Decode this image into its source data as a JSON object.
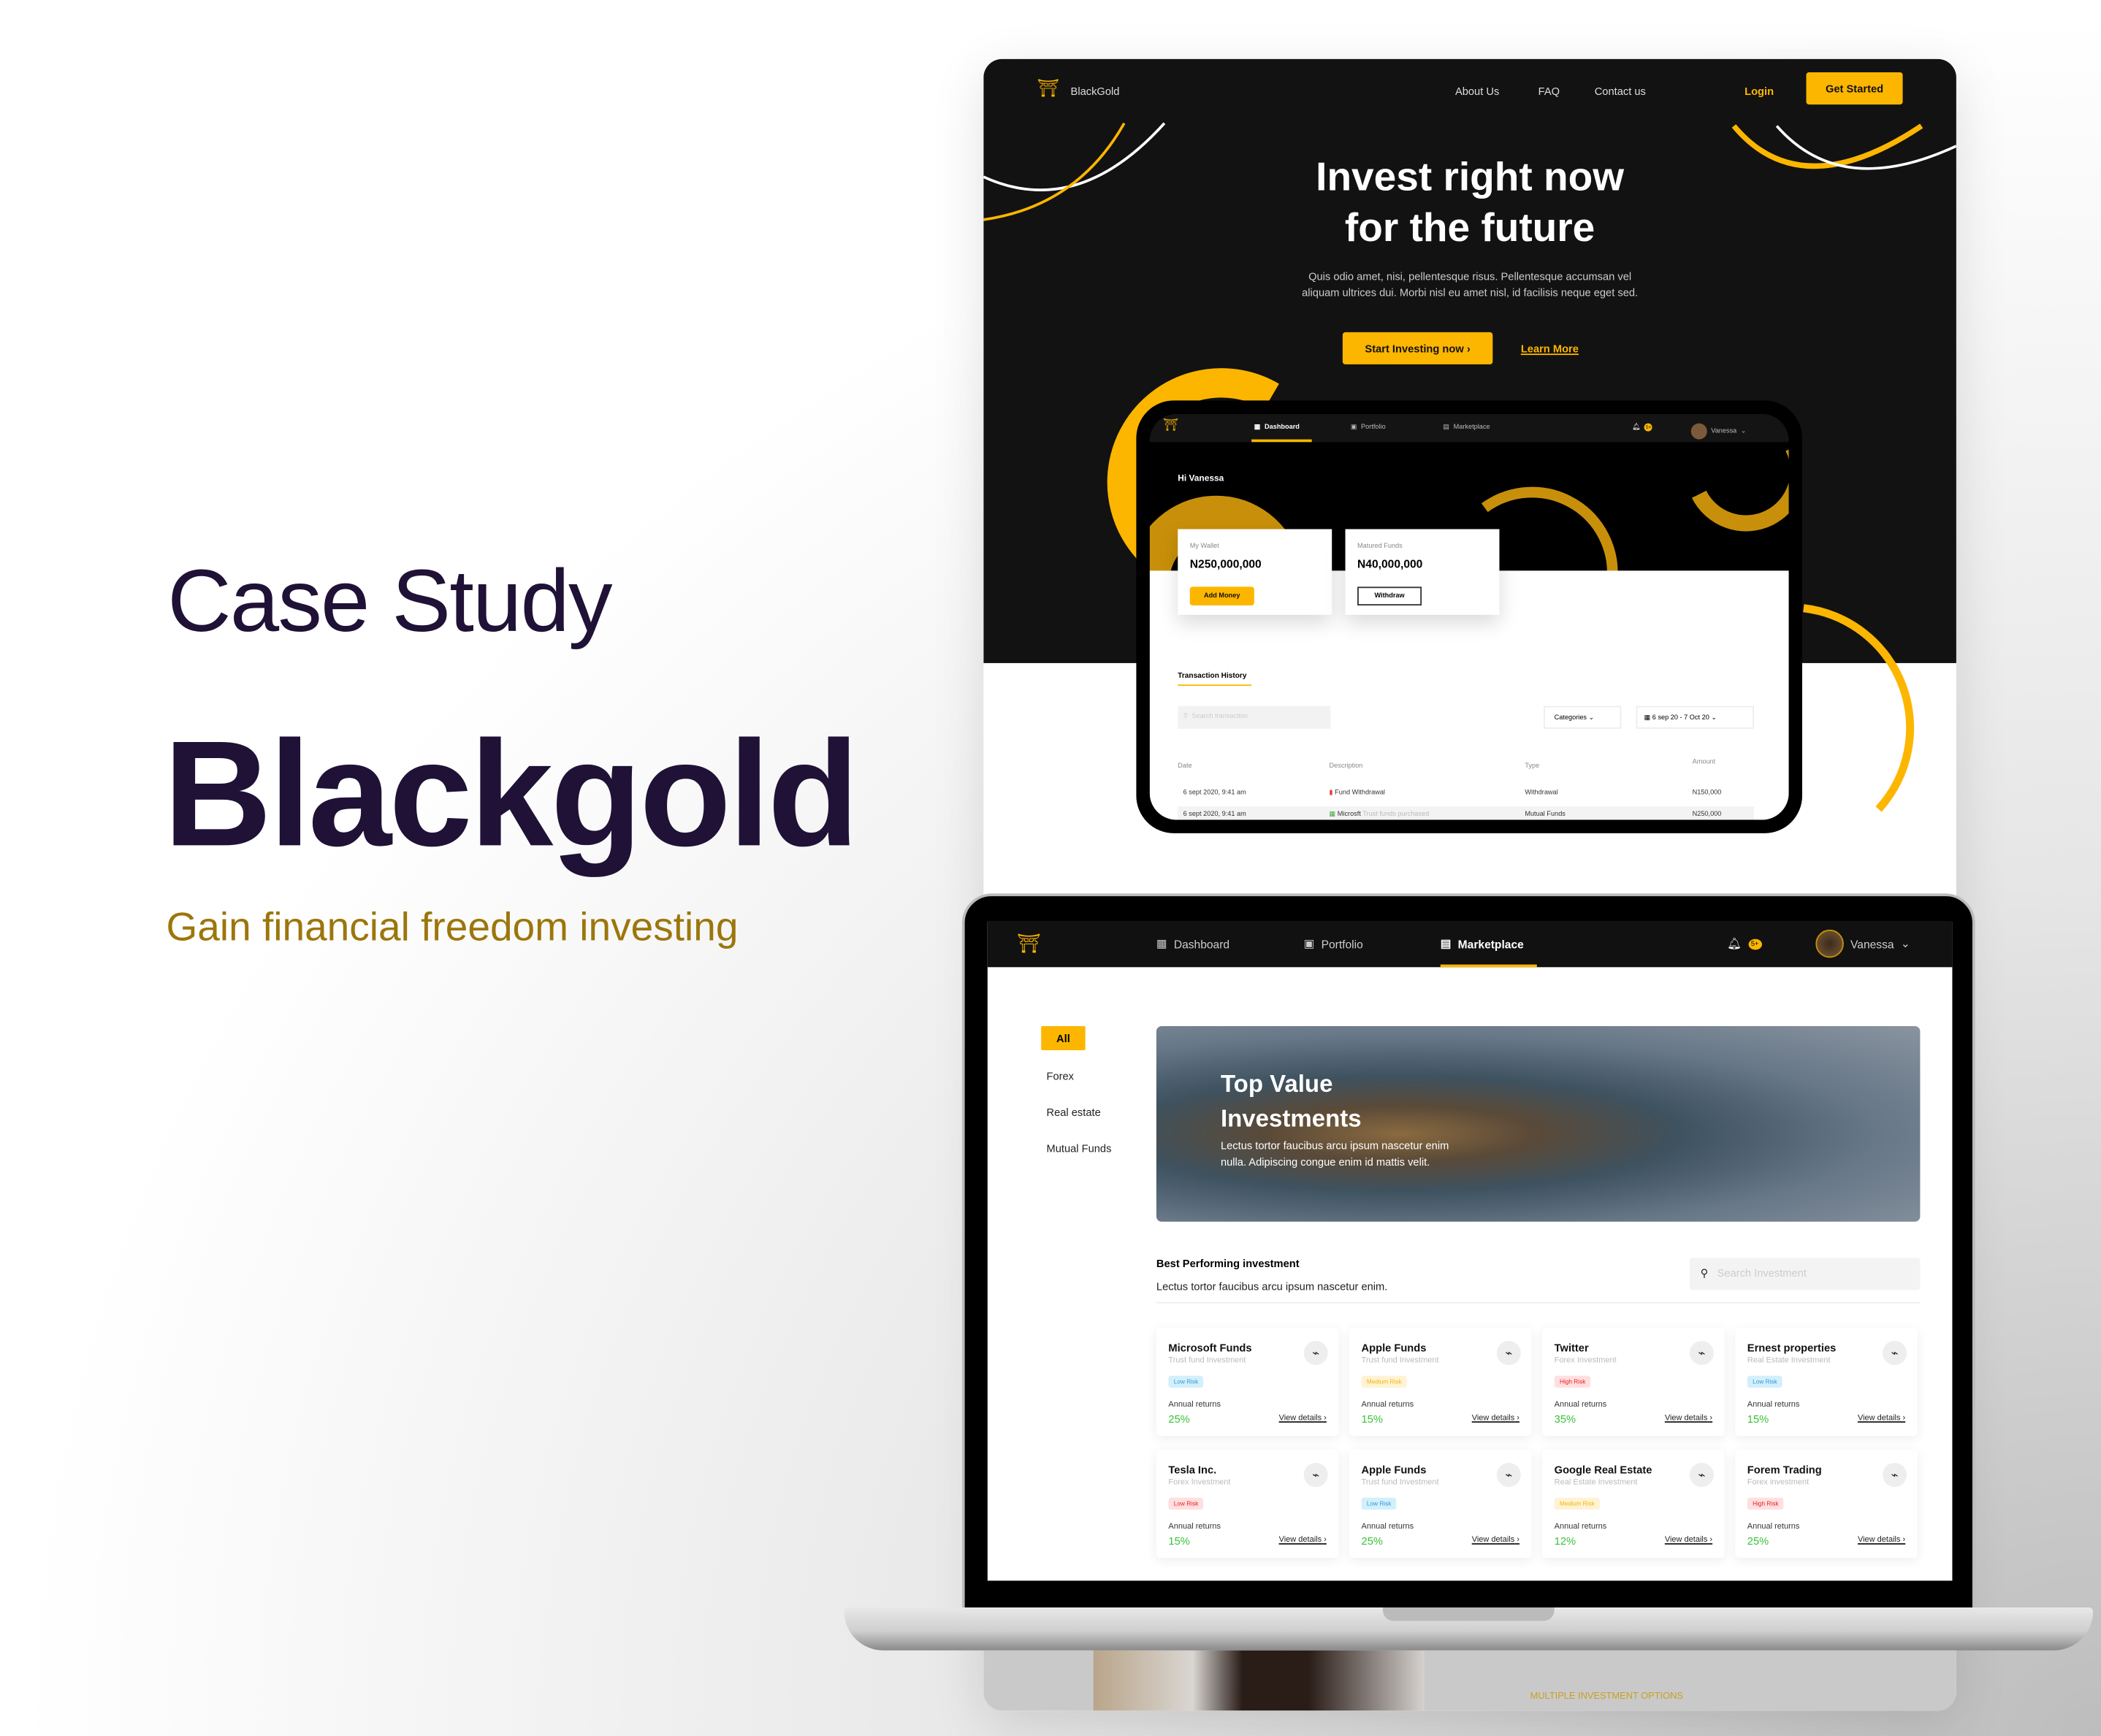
{
  "hero_left": {
    "eyebrow": "Case Study",
    "title": "Blackgold",
    "tagline": "Gain financial freedom investing"
  },
  "site": {
    "brand": "BlackGold",
    "nav": [
      "About Us",
      "FAQ",
      "Contact us"
    ],
    "login": "Login",
    "get_started": "Get Started",
    "headline": [
      "Invest right now",
      "for the future"
    ],
    "paragraph": [
      "Quis odio amet, nisi, pellentesque risus. Pellentesque accumsan vel",
      "aliquam ultrices dui. Morbi nisl eu amet nisl, id facilisis neque eget sed."
    ],
    "cta_primary": "Start Investing now",
    "cta_secondary": "Learn More",
    "bottom_label": "MULTIPLE INVESTMENT OPTIONS"
  },
  "dashboard": {
    "nav": [
      "Dashboard",
      "Portfolio",
      "Marketplace"
    ],
    "badge": "5+",
    "user": "Vanessa",
    "greeting": "Hi Vanessa",
    "wallet": {
      "label": "My Wallet",
      "amount": "N250,000,000",
      "button": "Add Money"
    },
    "matured": {
      "label": "Matured Funds",
      "amount": "N40,000,000",
      "button": "Withdraw"
    },
    "history_title": "Transaction History",
    "search_placeholder": "Search transaction",
    "categories": "Categories",
    "date_range": "6 sep 20 - 7 Oct 20",
    "columns": [
      "Date",
      "Description",
      "Type",
      "Amount"
    ],
    "rows": [
      {
        "date": "6 sept 2020, 9:41 am",
        "desc": "Fund Withdrawal",
        "note": "",
        "type": "Withdrawal",
        "amount": "N150,000"
      },
      {
        "date": "6 sept 2020, 9:41 am",
        "desc": "Microsft",
        "note": "Trust funds purchased",
        "type": "Mutual Funds",
        "amount": "N250,000"
      }
    ]
  },
  "marketplace": {
    "nav": [
      "Dashboard",
      "Portfolio",
      "Marketplace"
    ],
    "active": "Marketplace",
    "badge": "5+",
    "user": "Vanessa",
    "filters": [
      "All",
      "Forex",
      "Real estate",
      "Mutual Funds"
    ],
    "banner": {
      "title": [
        "Top Value",
        "Investments"
      ],
      "text": [
        "Lectus tortor faucibus arcu ipsum nascetur enim",
        "nulla. Adipiscing congue enim id mattis velit."
      ]
    },
    "section_title": "Best Performing investment",
    "section_sub": "Lectus tortor faucibus arcu ipsum nascetur enim.",
    "search_placeholder": "Search Investment",
    "returns_label": "Annual returns",
    "details_label": "View details",
    "cards": [
      {
        "name": "Microsoft Funds",
        "type": "Trust fund Investment",
        "risk": "Low Risk",
        "risk_color": "blue",
        "ret": "25%"
      },
      {
        "name": "Apple Funds",
        "type": "Trust fund Investment",
        "risk": "Medium Risk",
        "risk_color": "yellow",
        "ret": "15%"
      },
      {
        "name": "Twitter",
        "type": "Forex Investment",
        "risk": "High Risk",
        "risk_color": "red",
        "ret": "35%"
      },
      {
        "name": "Ernest properties",
        "type": "Real Estate Investment",
        "risk": "Low Risk",
        "risk_color": "blue",
        "ret": "15%"
      },
      {
        "name": "Tesla Inc.",
        "type": "Forex Investment",
        "risk": "Low Risk",
        "risk_color": "red",
        "ret": "15%"
      },
      {
        "name": "Apple Funds",
        "type": "Trust fund Investment",
        "risk": "Low Risk",
        "risk_color": "blue",
        "ret": "25%"
      },
      {
        "name": "Google Real Estate",
        "type": "Real Estate Investment",
        "risk": "Medium Risk",
        "risk_color": "yellow",
        "ret": "12%"
      },
      {
        "name": "Forem Trading",
        "type": "Forex investment",
        "risk": "High Risk",
        "risk_color": "red",
        "ret": "25%"
      }
    ]
  },
  "colors": {
    "accent": "#fdb600",
    "dark": "#121212",
    "title": "#1f1236",
    "tagline": "#9c760c",
    "positive": "#3cc13b"
  }
}
